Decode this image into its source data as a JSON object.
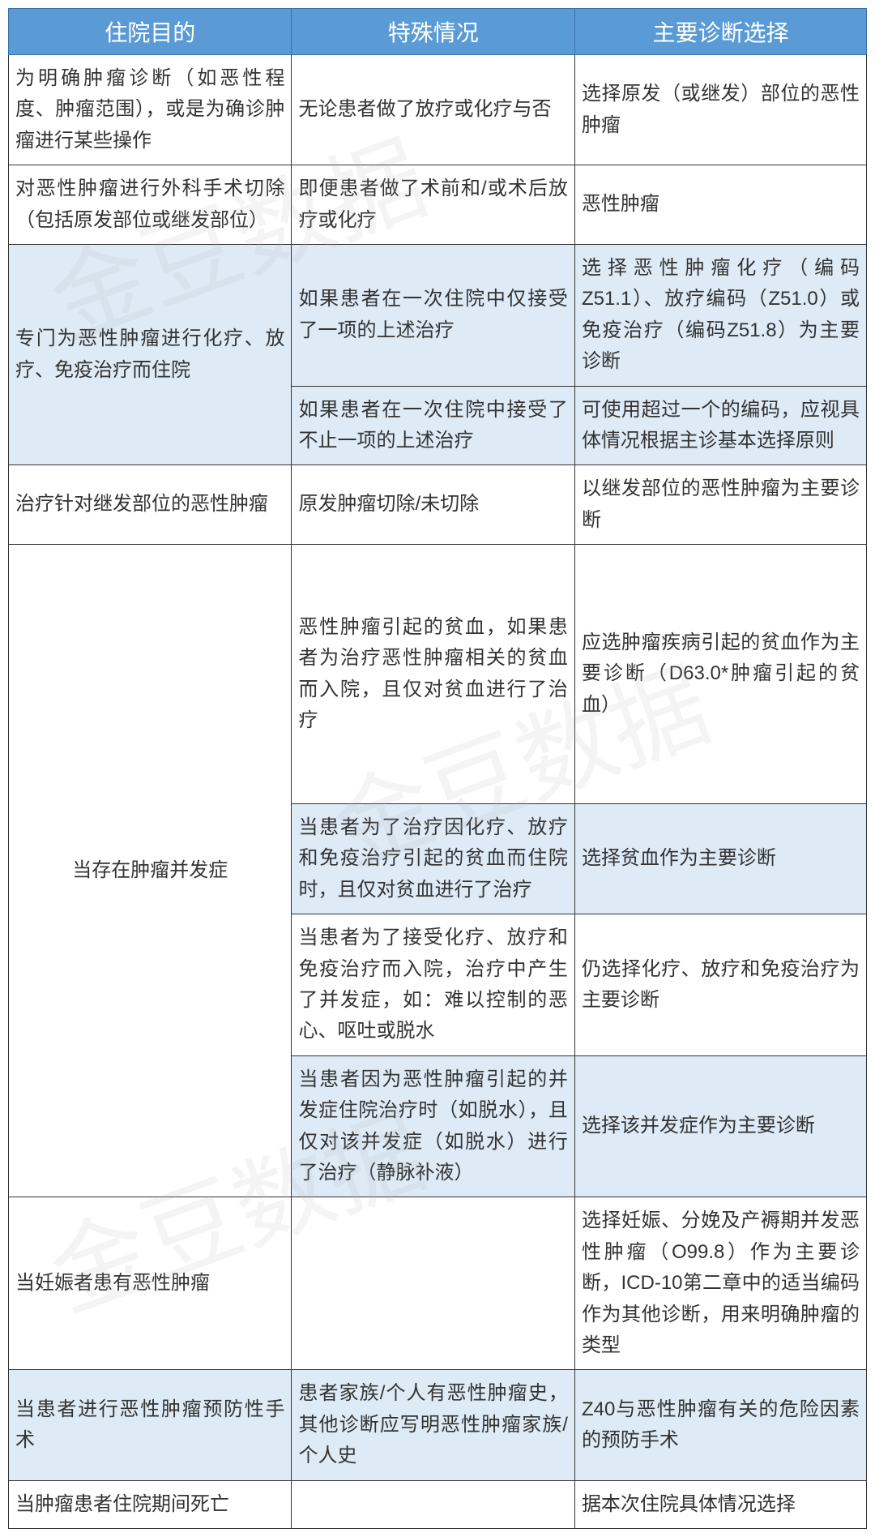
{
  "headers": {
    "col1": "住院目的",
    "col2": "特殊情况",
    "col3": "主要诊断选择"
  },
  "rows": {
    "r1": {
      "purpose": "为明确肿瘤诊断（如恶性程度、肿瘤范围），或是为确诊肿瘤进行某些操作",
      "condition": "无论患者做了放疗或化疗与否",
      "diagnosis": "选择原发（或继发）部位的恶性肿瘤"
    },
    "r2": {
      "purpose": "对恶性肿瘤进行外科手术切除（包括原发部位或继发部位）",
      "condition": "即便患者做了术前和/或术后放疗或化疗",
      "diagnosis": "恶性肿瘤"
    },
    "r3": {
      "purpose": "专门为恶性肿瘤进行化疗、放疗、免疫治疗而住院",
      "condition_a": "如果患者在一次住院中仅接受了一项的上述治疗",
      "diagnosis_a": "选择恶性肿瘤化疗（编码Z51.1）、放疗编码（Z51.0）或免疫治疗（编码Z51.8）为主要诊断",
      "condition_b": "如果患者在一次住院中接受了不止一项的上述治疗",
      "diagnosis_b": "可使用超过一个的编码，应视具体情况根据主诊基本选择原则"
    },
    "r4": {
      "purpose": "治疗针对继发部位的恶性肿瘤",
      "condition": "原发肿瘤切除/未切除",
      "diagnosis": "以继发部位的恶性肿瘤为主要诊断"
    },
    "r5": {
      "purpose": "当存在肿瘤并发症",
      "condition_a": "恶性肿瘤引起的贫血，如果患者为治疗恶性肿瘤相关的贫血而入院，且仅对贫血进行了治疗",
      "diagnosis_a": "应选肿瘤疾病引起的贫血作为主要诊断（D63.0*肿瘤引起的贫血）",
      "condition_b": "当患者为了治疗因化疗、放疗和免疫治疗引起的贫血而住院时，且仅对贫血进行了治疗",
      "diagnosis_b": "选择贫血作为主要诊断",
      "condition_c": "当患者为了接受化疗、放疗和免疫治疗而入院，治疗中产生了并发症，如：难以控制的恶心、呕吐或脱水",
      "diagnosis_c": "仍选择化疗、放疗和免疫治疗为主要诊断",
      "condition_d": "当患者因为恶性肿瘤引起的并发症住院治疗时（如脱水），且仅对该并发症（如脱水）进行了治疗（静脉补液）",
      "diagnosis_d": "选择该并发症作为主要诊断"
    },
    "r6": {
      "purpose": "当妊娠者患有恶性肿瘤",
      "condition": "",
      "diagnosis": "选择妊娠、分娩及产褥期并发恶性肿瘤（O99.8）作为主要诊断，ICD-10第二章中的适当编码作为其他诊断，用来明确肿瘤的类型"
    },
    "r7": {
      "purpose": "当患者进行恶性肿瘤预防性手术",
      "condition": "患者家族/个人有恶性肿瘤史，其他诊断应写明恶性肿瘤家族/个人史",
      "diagnosis": "Z40与恶性肿瘤有关的危险因素的预防手术"
    },
    "r8": {
      "purpose": "当肿瘤患者住院期间死亡",
      "condition": "",
      "diagnosis": "据本次住院具体情况选择"
    }
  }
}
